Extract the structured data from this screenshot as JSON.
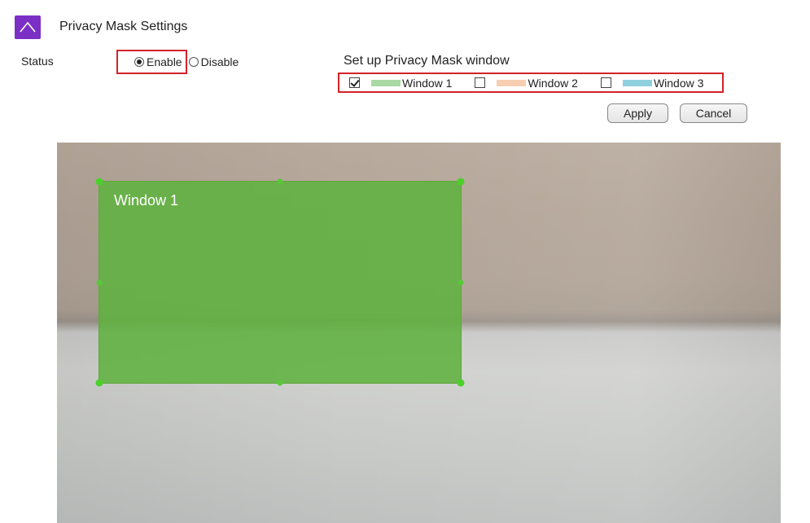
{
  "header": {
    "title": "Privacy Mask Settings",
    "collapse_icon": "chevron-up-icon",
    "accent_color": "#7c2fc4"
  },
  "status": {
    "label": "Status",
    "options": [
      {
        "label": "Enable",
        "checked": true
      },
      {
        "label": "Disable",
        "checked": false
      }
    ]
  },
  "mask_setup": {
    "title": "Set up Privacy Mask window",
    "windows": [
      {
        "label": "Window 1",
        "checked": true,
        "color": "#a8d9a4"
      },
      {
        "label": "Window 2",
        "checked": false,
        "color": "#f7ceb1"
      },
      {
        "label": "Window 3",
        "checked": false,
        "color": "#8fd0de"
      }
    ]
  },
  "actions": {
    "apply_label": "Apply",
    "cancel_label": "Cancel"
  },
  "camera_view": {
    "mask_label": "Window 1",
    "mask_color": "#60b240",
    "handle_color": "#4cd02a"
  }
}
